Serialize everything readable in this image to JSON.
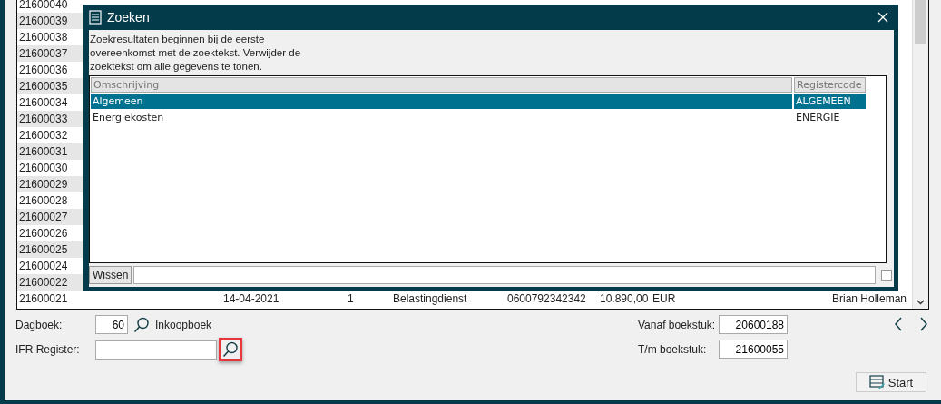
{
  "table": {
    "rows": [
      [
        "21600040"
      ],
      [
        "21600039"
      ],
      [
        "21600038"
      ],
      [
        "21600037"
      ],
      [
        "21600036"
      ],
      [
        "21600035"
      ],
      [
        "21600034"
      ],
      [
        "21600033"
      ],
      [
        "21600032"
      ],
      [
        "21600031"
      ],
      [
        "21600030"
      ],
      [
        "21600029"
      ],
      [
        "21600028"
      ],
      [
        "21600027"
      ],
      [
        "21600026"
      ],
      [
        "21600025"
      ],
      [
        "21600024"
      ],
      [
        "21600022"
      ],
      [
        "21600021",
        "14-04-2021",
        "1",
        "Belastingdienst",
        "0600792342342",
        "10.890,00",
        "EUR",
        "Brian Holleman"
      ]
    ]
  },
  "form": {
    "dagboek": {
      "label": "Dagboek:",
      "value": "60",
      "name": "Inkoopboek"
    },
    "ifr_register": {
      "label": "IFR Register:",
      "highlighted": true
    },
    "vanaf": {
      "label": "Vanaf boekstuk:",
      "value": "20600188"
    },
    "tm": {
      "label": "T/m boekstuk:",
      "value": "21600055"
    },
    "start_button": "Start"
  },
  "dialog": {
    "title": "Zoeken",
    "description": "Zoekresultaten beginnen bij de eerste overeenkomst met de zoektekst. Verwijder de zoektekst om alle gegevens te tonen.",
    "columns": [
      "Omschrijving",
      "Registercode"
    ],
    "rows": [
      {
        "cells": [
          "Algemeen",
          "ALGEMEEN"
        ],
        "selected": true
      },
      {
        "cells": [
          "Energiekosten",
          "ENERGIE"
        ],
        "selected": false
      }
    ],
    "clear_button": "Wissen",
    "checked": false
  }
}
